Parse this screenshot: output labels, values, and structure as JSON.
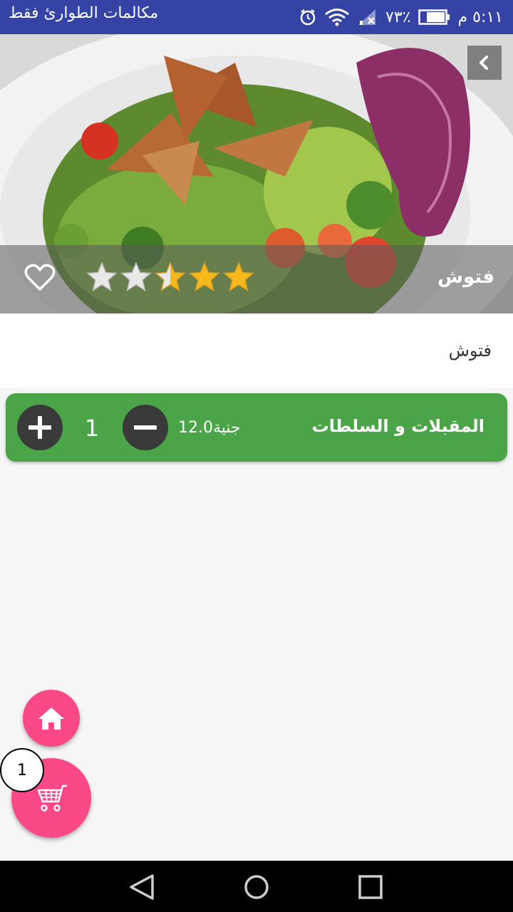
{
  "status_bar": {
    "carrier_text": "مكالمات الطوارئ فقط",
    "time": "٥:١١ م",
    "battery": "٧٣٪",
    "icons": [
      "alarm-icon",
      "wifi-icon",
      "signal-icon",
      "battery-icon"
    ]
  },
  "item": {
    "title": "فتوش",
    "rating": 2.5,
    "rating_max": 5,
    "description": "فتوش",
    "favorite": false
  },
  "order": {
    "category": "المقبلات و السلطات",
    "price": "12.0جنية",
    "quantity": "1"
  },
  "cart": {
    "badge_count": "1"
  },
  "colors": {
    "status_bar": "#3543a5",
    "card_green": "#4ba548",
    "fab_pink": "#fb4987",
    "button_dark": "#3a3a3a"
  }
}
